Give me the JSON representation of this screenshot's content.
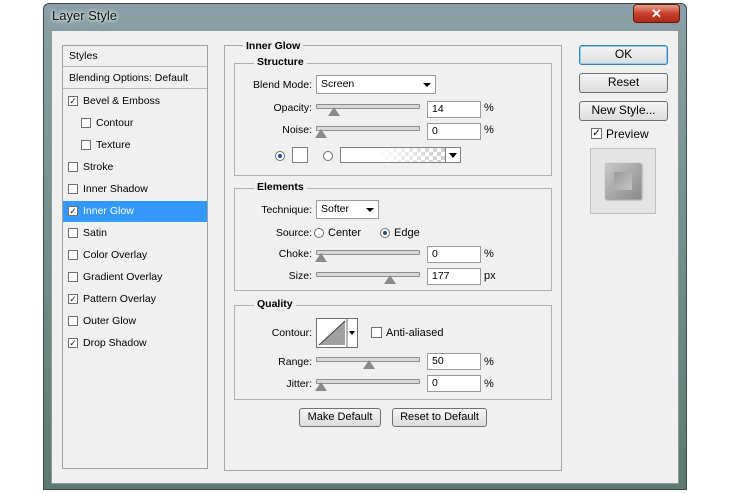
{
  "window": {
    "title": "Layer Style",
    "close_glyph": "✕"
  },
  "styles_list": {
    "header": "Styles",
    "blending": "Blending Options: Default",
    "items": [
      {
        "label": "Bevel & Emboss",
        "checked": true
      },
      {
        "label": "Contour",
        "checked": false
      },
      {
        "label": "Texture",
        "checked": false
      },
      {
        "label": "Stroke",
        "checked": false
      },
      {
        "label": "Inner Shadow",
        "checked": false
      },
      {
        "label": "Inner Glow",
        "checked": true
      },
      {
        "label": "Satin",
        "checked": false
      },
      {
        "label": "Color Overlay",
        "checked": false
      },
      {
        "label": "Gradient Overlay",
        "checked": false
      },
      {
        "label": "Pattern Overlay",
        "checked": true
      },
      {
        "label": "Outer Glow",
        "checked": false
      },
      {
        "label": "Drop Shadow",
        "checked": true
      }
    ]
  },
  "inner_glow": {
    "title": "Inner Glow",
    "structure": {
      "title": "Structure",
      "blend_mode_label": "Blend Mode:",
      "blend_mode_value": "Screen",
      "opacity_label": "Opacity:",
      "opacity_value": "14",
      "opacity_unit": "%",
      "noise_label": "Noise:",
      "noise_value": "0",
      "noise_unit": "%",
      "color_mode": "solid"
    },
    "elements": {
      "title": "Elements",
      "technique_label": "Technique:",
      "technique_value": "Softer",
      "source_label": "Source:",
      "source_center": "Center",
      "source_edge": "Edge",
      "source_selected": "Edge",
      "choke_label": "Choke:",
      "choke_value": "0",
      "choke_unit": "%",
      "size_label": "Size:",
      "size_value": "177",
      "size_unit": "px"
    },
    "quality": {
      "title": "Quality",
      "contour_label": "Contour:",
      "anti_aliased_label": "Anti-aliased",
      "anti_aliased": false,
      "range_label": "Range:",
      "range_value": "50",
      "range_unit": "%",
      "jitter_label": "Jitter:",
      "jitter_value": "0",
      "jitter_unit": "%"
    },
    "make_default": "Make Default",
    "reset_default": "Reset to Default"
  },
  "right": {
    "ok": "OK",
    "reset": "Reset",
    "new_style": "New Style...",
    "preview_label": "Preview",
    "preview_checked": true
  },
  "colors": {
    "selection": "#3399ff",
    "ok_border": "#3c7fb1"
  }
}
